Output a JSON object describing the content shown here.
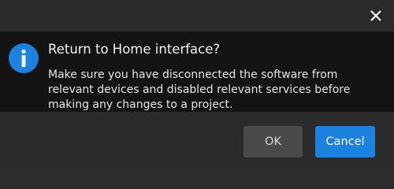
{
  "dialog": {
    "title": "Return to Home interface?",
    "message": "Make sure you have disconnected the software from relevant devices and disabled relevant services before making any changes to a project.",
    "icon": "info-icon",
    "close_icon": "close-icon"
  },
  "buttons": {
    "ok_label": "OK",
    "cancel_label": "Cancel"
  },
  "colors": {
    "accent": "#1b82e0",
    "background": "#141414",
    "bar": "#2b2b2b",
    "secondary_button": "#4a4a4a"
  }
}
